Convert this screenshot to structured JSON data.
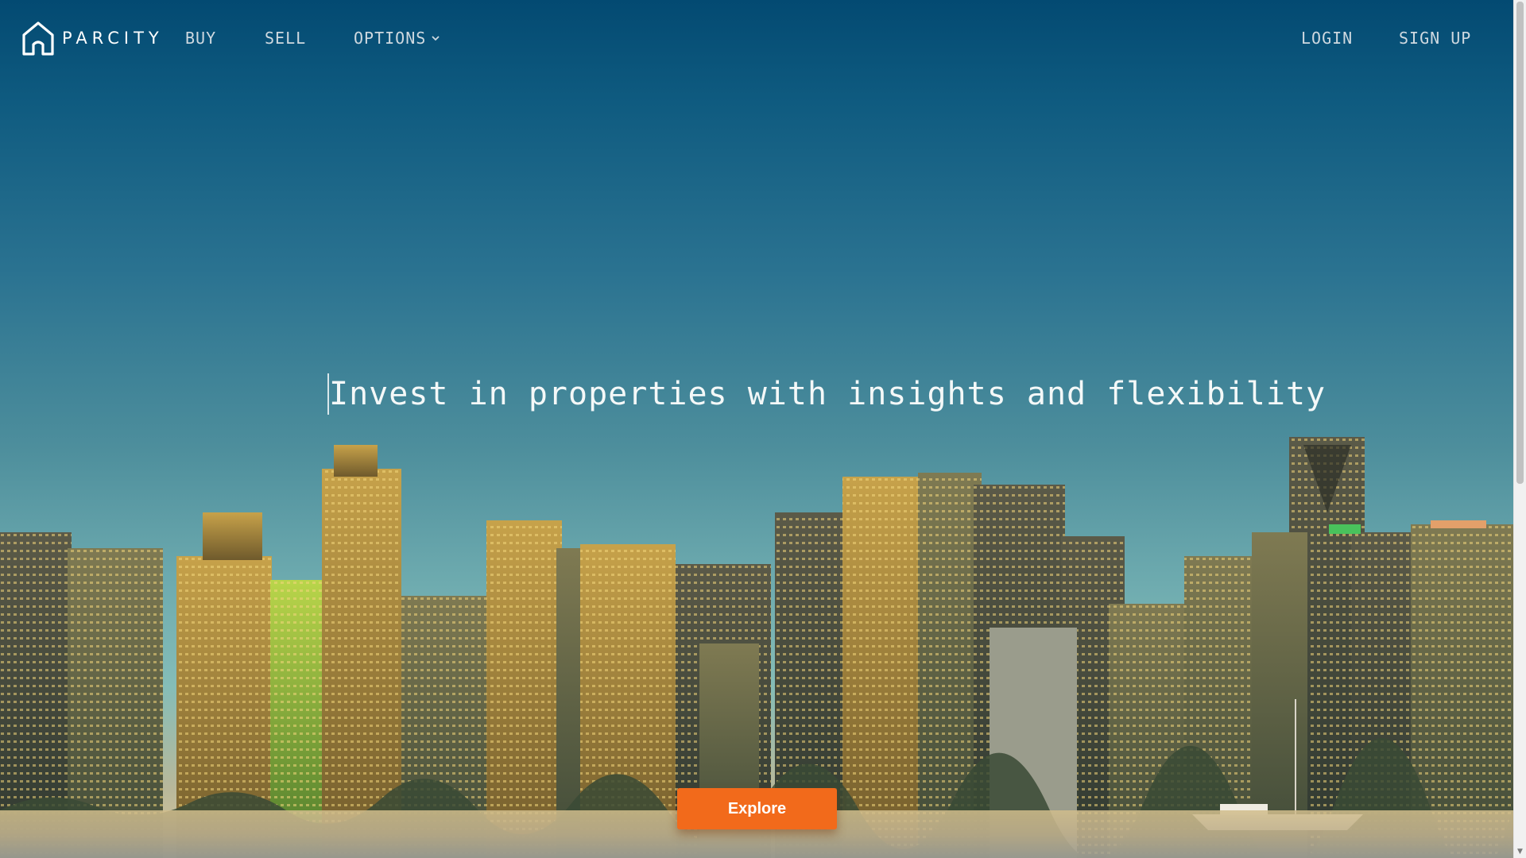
{
  "brand": {
    "name": "PARCITY",
    "logo_icon": "house-outline-icon"
  },
  "nav": {
    "buy": "BUY",
    "sell": "SELL",
    "options": "OPTIONS",
    "options_icon": "chevron-down-icon",
    "login": "LOGIN",
    "signup": "SIGN UP"
  },
  "hero": {
    "title": "Invest in properties with insights and flexibility",
    "cta": "Explore"
  },
  "colors": {
    "accent": "#f26a1b",
    "sky_top": "#034a72",
    "sky_bottom": "#85bdb7"
  }
}
